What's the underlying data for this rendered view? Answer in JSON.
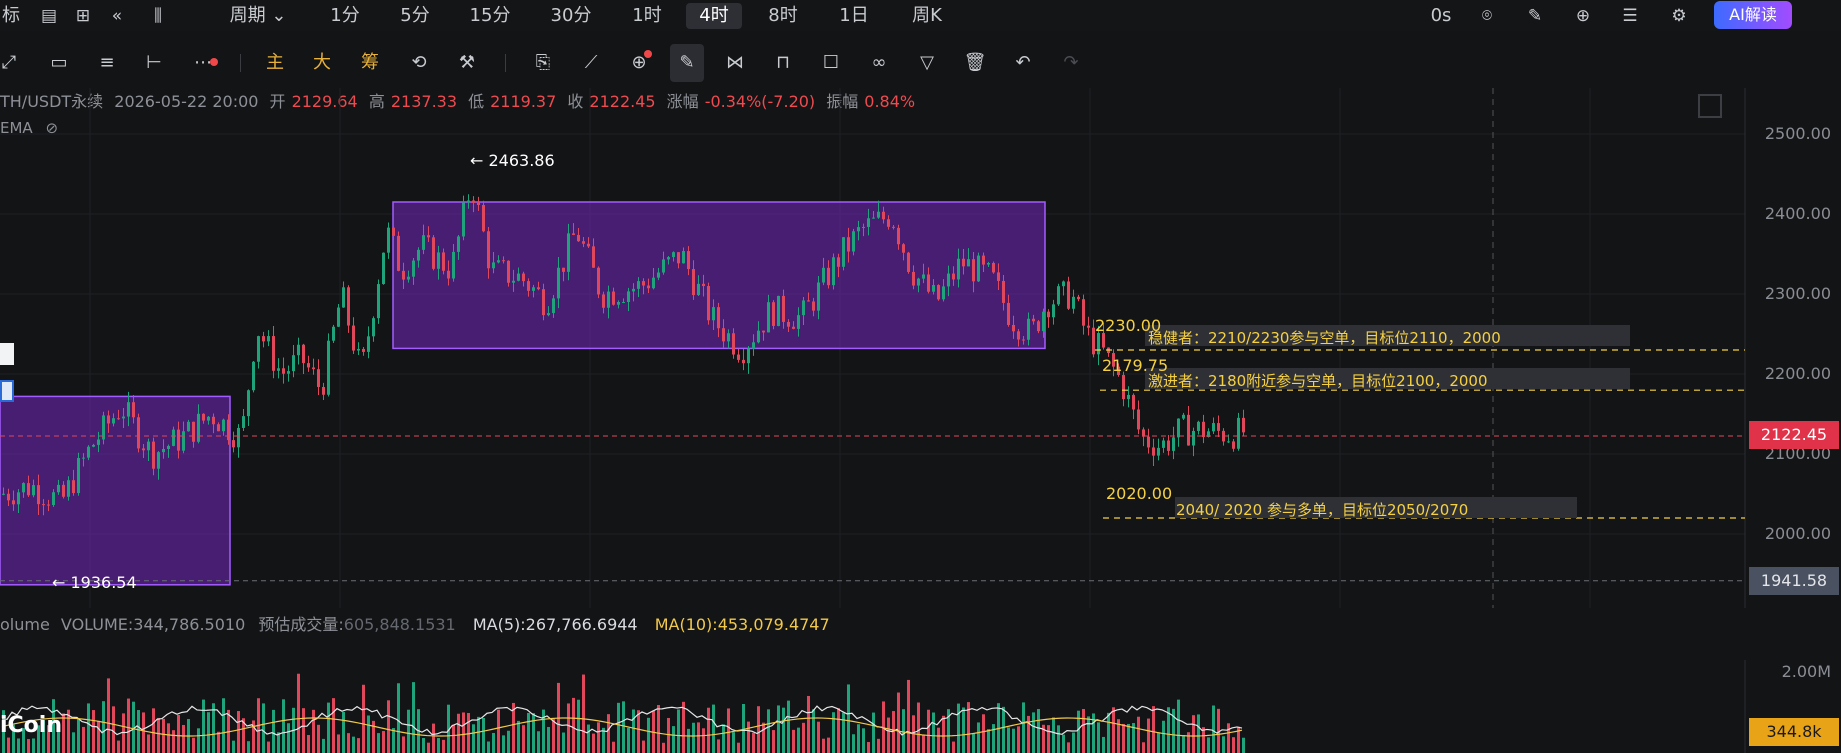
{
  "toolbar": {
    "indicators_label": "标",
    "period_label": "周期",
    "intervals": [
      "1分",
      "5分",
      "15分",
      "30分",
      "1时",
      "4时",
      "8时",
      "1日",
      "周K"
    ],
    "active_interval": "4时",
    "countdown": "0s",
    "ai_button": "AI解读"
  },
  "drawbar": {
    "main_label": "主",
    "big_label": "大",
    "chips_label": "筹"
  },
  "info": {
    "symbol": "TH/USDT永续",
    "datetime": "2026-05-22 20:00",
    "open_label": "开",
    "open": "2129.64",
    "high_label": "高",
    "high": "2137.33",
    "low_label": "低",
    "low": "2119.37",
    "close_label": "收",
    "close": "2122.45",
    "change_label": "涨幅",
    "change": "-0.34%(-7.20)",
    "amplitude_label": "振幅",
    "amplitude": "0.84%",
    "ema_label": "EMA"
  },
  "price_axis": {
    "ticks": [
      "2500.00",
      "2400.00",
      "2300.00",
      "2200.00",
      "2100.00",
      "2000.00"
    ],
    "current_price": "2122.45",
    "low_marker": "1941.58",
    "volume_tick": "2.00M",
    "volume_current": "344.8k"
  },
  "annotations": {
    "high_point": "2463.86",
    "low_point": "1936.54",
    "level_2230": "2230.00",
    "level_2179": "2179.75",
    "level_2020": "2020.00",
    "conservative_text": "稳健者：2210/2230参与空单，目标位2110，2000",
    "aggressive_text": "激进者：2180附近参与空单，目标位2100，2000",
    "long_text": "2040/ 2020 参与多单，目标位2050/2070"
  },
  "volume": {
    "label": "olume",
    "volume_value": "VOLUME:344,786.5010",
    "estimate_label": "预估成交量:",
    "estimate_value": "605,848.1531",
    "ma5": "MA(5):267,766.6944",
    "ma10": "MA(10):453,079.4747"
  },
  "logo": "iCoin",
  "colors": {
    "up": "#1fa37a",
    "down": "#e0475b",
    "box": "#8a2be2",
    "annotation": "#f5d142",
    "ai_start": "#3d6bff",
    "ai_end": "#a24cff"
  }
}
